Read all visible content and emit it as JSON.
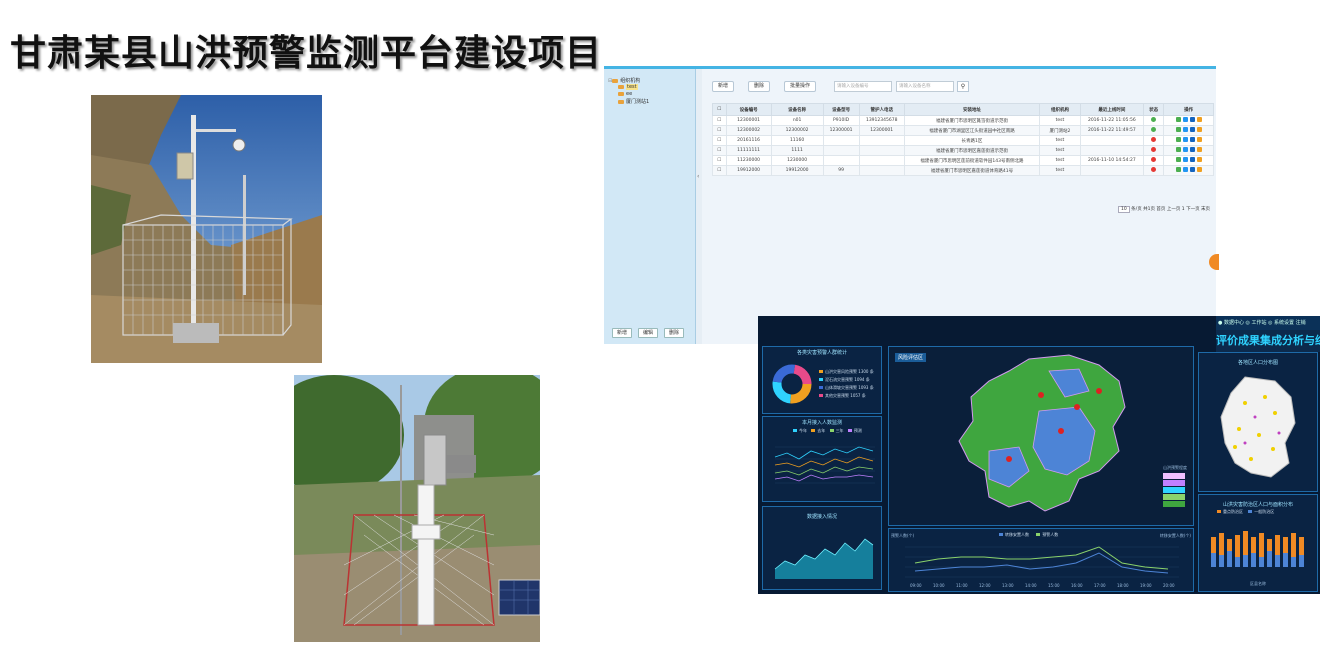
{
  "page": {
    "title": "甘肃某县山洪预警监测平台建设项目"
  },
  "device_app": {
    "tree": {
      "root": "组织机构",
      "nodes": [
        "test",
        "ee",
        "厦门测站1"
      ]
    },
    "left_buttons": [
      "新增",
      "编辑",
      "删除"
    ],
    "toolbar": {
      "add": "新增",
      "delete": "删除",
      "batch": "批量操作",
      "input1_placeholder": "请输入设备编号",
      "input2_placeholder": "请输入设备名称"
    },
    "table": {
      "headers": [
        "",
        "设备编号",
        "设备名称",
        "设备型号",
        "管护人电话",
        "安装地址",
        "组织机构",
        "最近上线时间",
        "状态",
        "操作"
      ],
      "rows": [
        {
          "id": "12300001",
          "name": "n01",
          "model": "P910ID",
          "phone": "13912345678",
          "addr": "福建省厦门市思明区篔筜街道示范街",
          "org": "test",
          "time": "2016-11-22 11:05:56",
          "status": "ok"
        },
        {
          "id": "12300002",
          "name": "12300002",
          "model": "12300001",
          "phone": "12300001",
          "addr": "福建省厦门市湖里区江头街道园中社区南路",
          "org": "厦门测站2",
          "time": "2016-11-22 11:49:57",
          "status": "ok"
        },
        {
          "id": "20161116",
          "name": "11160",
          "model": "",
          "phone": "",
          "addr": "长青路1区",
          "org": "test",
          "time": "",
          "status": "err"
        },
        {
          "id": "11111111",
          "name": "1111",
          "model": "",
          "phone": "",
          "addr": "福建省厦门市思明区嘉莲街道示范街",
          "org": "test",
          "time": "",
          "status": "err"
        },
        {
          "id": "11230000",
          "name": "1230000",
          "model": "",
          "phone": "",
          "addr": "福建省厦门市思明区莲前街道软件园143号南侧北路",
          "org": "test",
          "time": "2016-11-10 14:54:27",
          "status": "err"
        },
        {
          "id": "19912000",
          "name": "19912000",
          "model": "99",
          "phone": "",
          "addr": "福建省厦门市思明区嘉莲街道体育路41号",
          "org": "test",
          "time": "",
          "status": "err"
        }
      ]
    },
    "pager": {
      "size": "10",
      "text": "条/页  共1页  首页 上一页 1 下一页 末页"
    }
  },
  "dashboard": {
    "topbar": "● 数据中心  ◎ 工作站  ◎ 系统设置  注销",
    "banner": "评价成果集成分析与综合应用",
    "panels": {
      "donut_title": "各类灾害预警人群统计",
      "line_title": "本月接入人数监测",
      "area_title": "数据接入情况",
      "map_tag": "风险评估区",
      "right_map_title": "各地区人口分布图",
      "bar_title": "山洪灾害防治区人口与面积分布"
    },
    "donut_legend": [
      "山洪灾害风险预警 1300 条",
      "泥石流灾害预警 1094 条",
      "山体滑坡灾害预警 1093 条",
      "其他灾害预警 1057 条"
    ],
    "line_legend": [
      "今年",
      "去年",
      "三年",
      "预测"
    ],
    "bottom_legend": [
      "转移安置人数",
      "预警人数"
    ],
    "bottom_axis_left": "预警人数(个)",
    "bottom_axis_right": "转移安置人数(个)",
    "bottom_x": [
      "09:00",
      "10:00",
      "11:00",
      "12:00",
      "13:00",
      "14:00",
      "15:00",
      "16:00",
      "17:00",
      "18:00",
      "19:00",
      "20:00"
    ],
    "bar_legend": [
      "重点防治区",
      "一般防治区"
    ],
    "bar_xlabel": "区县名称",
    "risk_legend_title": "山洪预警程度",
    "colors": {
      "green": "#3fa63f",
      "blue": "#4d84d6",
      "accent": "#2fd3ff"
    }
  }
}
